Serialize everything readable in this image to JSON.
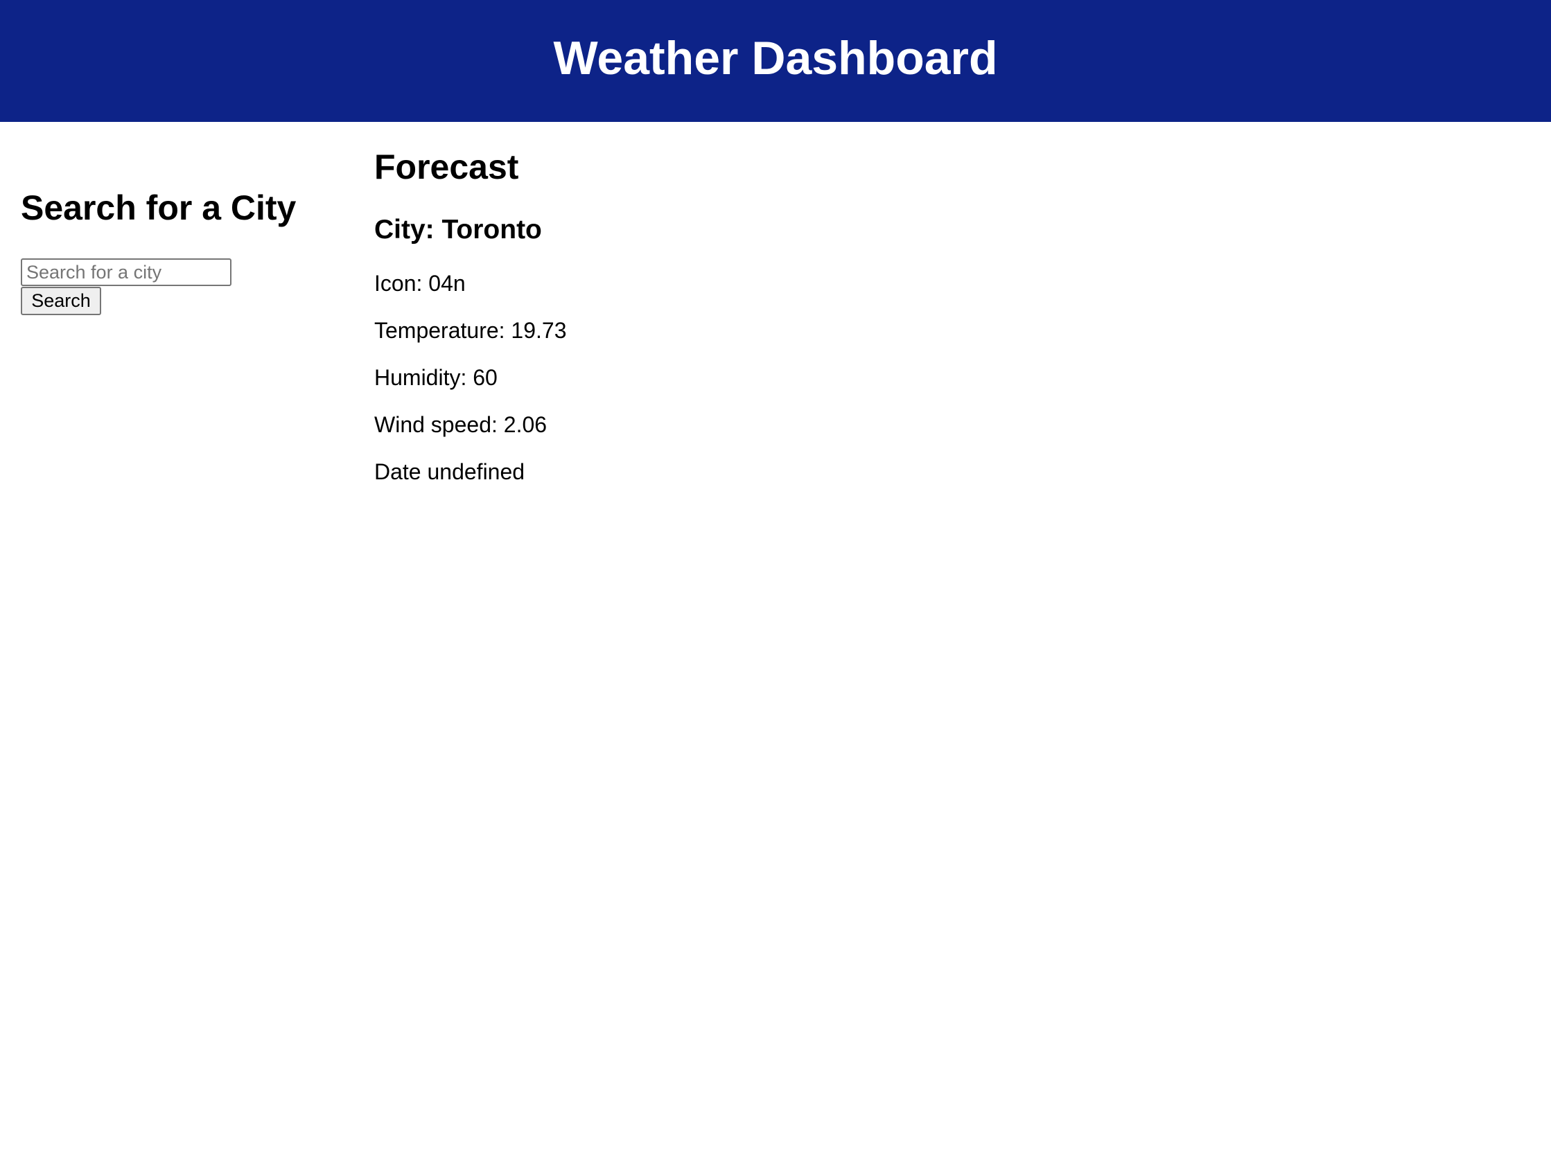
{
  "header": {
    "title": "Weather Dashboard"
  },
  "search": {
    "heading": "Search for a City",
    "placeholder": "Search for a city",
    "button_label": "Search"
  },
  "forecast": {
    "heading": "Forecast",
    "city": "City: Toronto",
    "icon": "Icon: 04n",
    "temperature": "Temperature: 19.73",
    "humidity": "Humidity: 60",
    "wind_speed": "Wind speed: 2.06",
    "date": "Date undefined"
  },
  "colors": {
    "header_bg": "#0d2388",
    "header_text": "#ffffff"
  }
}
